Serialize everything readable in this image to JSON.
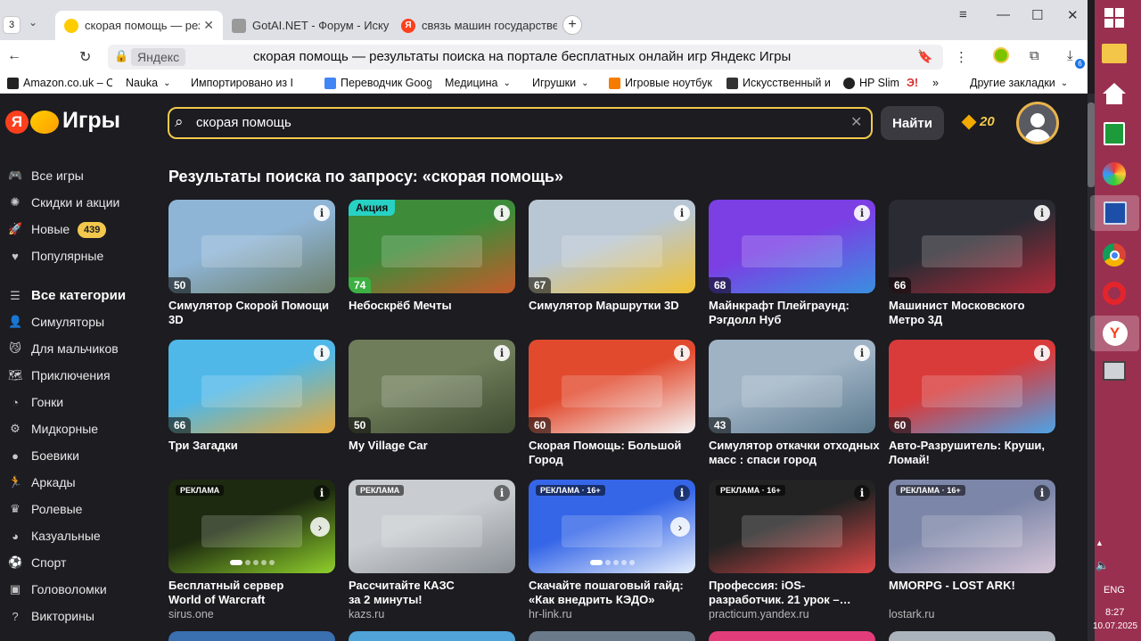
{
  "browser": {
    "tab_count": "3",
    "tabs": [
      {
        "title": "скорая помощь — резу",
        "favicon_color": "#ffcc00"
      },
      {
        "title": "GotAI.NET - Форум - Иску",
        "favicon_color": "#888888"
      },
      {
        "title": "связь машин государстве",
        "favicon_color": "#fc3f1d"
      }
    ],
    "domain_chip": "Яндекс",
    "page_title": "скорая помощь — результаты поиска на портале бесплатных онлайн игр Яндекс Игры",
    "download_badge": "6",
    "bookmarks": [
      {
        "label": "Amazon.co.uk – O",
        "color": "#222222"
      },
      {
        "label": "Nauka",
        "color": "#ffffff"
      },
      {
        "label": "Импортировано из I",
        "color": "#ffffff"
      },
      {
        "label": "Переводчик Goog",
        "color": "#4285f4"
      },
      {
        "label": "Медицина",
        "color": "#ffffff"
      },
      {
        "label": "Игрушки",
        "color": "#ffffff"
      },
      {
        "label": "Игровые ноутбук",
        "color": "#f57c00"
      },
      {
        "label": "Искусственный и",
        "color": "#333333"
      },
      {
        "label": "HP Slim",
        "color": "#222222"
      },
      {
        "label": "Другие закладки",
        "color": "#ffffff"
      }
    ]
  },
  "site": {
    "logo_text": "Игры",
    "logo_letter": "Я",
    "search_value": "скорая помощь",
    "find_button": "Найти",
    "coins": "20"
  },
  "sidebar": [
    {
      "label": "Все игры",
      "icon": "gamepad-icon",
      "glyph": "🎮"
    },
    {
      "label": "Скидки и акции",
      "icon": "discount-icon",
      "glyph": "✺"
    },
    {
      "label": "Новые",
      "icon": "rocket-icon",
      "glyph": "🚀",
      "badge": "439"
    },
    {
      "label": "Популярные",
      "icon": "heart-icon",
      "glyph": "♥"
    },
    {
      "label": "Все категории",
      "icon": "list-icon",
      "glyph": "☰",
      "heading": true
    },
    {
      "label": "Симуляторы",
      "icon": "person-icon",
      "glyph": "👤"
    },
    {
      "label": "Для мальчиков",
      "icon": "cat-icon",
      "glyph": "😼"
    },
    {
      "label": "Приключения",
      "icon": "map-icon",
      "glyph": "🗺"
    },
    {
      "label": "Гонки",
      "icon": "speed-icon",
      "glyph": "◔"
    },
    {
      "label": "Мидкорные",
      "icon": "gear-icon",
      "glyph": "⚙"
    },
    {
      "label": "Боевики",
      "icon": "bomb-icon",
      "glyph": "●"
    },
    {
      "label": "Аркады",
      "icon": "running-icon",
      "glyph": "🏃"
    },
    {
      "label": "Ролевые",
      "icon": "crown-icon",
      "glyph": "♛"
    },
    {
      "label": "Казуальные",
      "icon": "ball-icon",
      "glyph": "◕"
    },
    {
      "label": "Спорт",
      "icon": "sport-icon",
      "glyph": "⚽"
    },
    {
      "label": "Головоломки",
      "icon": "puzzle-icon",
      "glyph": "▣"
    },
    {
      "label": "Викторины",
      "icon": "quiz-icon",
      "glyph": "?"
    }
  ],
  "results_heading": "Результаты поиска по запросу: «скорая помощь»",
  "cards": [
    {
      "title1": "Симулятор Скорой Помощи",
      "title2": "3D",
      "rating": "50",
      "bg": "#8fb5d6",
      "bg2": "#6d7f6a"
    },
    {
      "title1": "Небоскрёб Мечты",
      "title2": "",
      "rating": "74",
      "bg": "#3e8c3a",
      "bg2": "#c55a2a",
      "promo": "Акция",
      "green": true
    },
    {
      "title1": "Симулятор Маршрутки 3D",
      "title2": "",
      "rating": "67",
      "bg": "#b9c6d3",
      "bg2": "#f1c232"
    },
    {
      "title1": "Майнкрафт Плейграунд:",
      "title2": "Рэгдолл Нуб",
      "rating": "68",
      "bg": "#7b3fe4",
      "bg2": "#3a8fe0"
    },
    {
      "title1": "Машинист Московского",
      "title2": "Метро 3Д",
      "rating": "66",
      "bg": "#2b2b33",
      "bg2": "#b02a3a"
    },
    {
      "title1": "Три Загадки",
      "title2": "",
      "rating": "66",
      "bg": "#4fb8e8",
      "bg2": "#e6a93a"
    },
    {
      "title1": "My Village Car",
      "title2": "",
      "rating": "50",
      "bg": "#6f7d5a",
      "bg2": "#3d4a30"
    },
    {
      "title1": "Скорая Помощь: Большой",
      "title2": "Город",
      "rating": "60",
      "bg": "#e24a2e",
      "bg2": "#f5f5f5"
    },
    {
      "title1": "Симулятор откачки отходных",
      "title2": "масс : спаси город",
      "rating": "43",
      "bg": "#9fb3c4",
      "bg2": "#5c7a8f"
    },
    {
      "title1": "Авто-Разрушитель: Круши,",
      "title2": "Ломай!",
      "rating": "60",
      "bg": "#d93a3a",
      "bg2": "#4da3e6"
    },
    {
      "title1": "Бесплатный сервер",
      "title2": "World of Warcraft",
      "sub": "sirus.one",
      "ad": "РЕКЛАМА",
      "bg": "#1d2a10",
      "bg2": "#8fd02c",
      "arrow": true,
      "dots": true
    },
    {
      "title1": "Рассчитайте КАЗС",
      "title2": "за 2 минуты!",
      "sub": "kazs.ru",
      "ad": "РЕКЛАМА",
      "bg": "#c9cdd1",
      "bg2": "#8b9096"
    },
    {
      "title1": "Скачайте пошаговый гайд:",
      "title2": "«Как внедрить КЭДО»",
      "sub": "hr-link.ru",
      "ad": "РЕКЛАМА · 16+",
      "bg": "#3566e8",
      "bg2": "#e5eefc",
      "arrow": true,
      "dots": true
    },
    {
      "title1": "Профессия: iOS-",
      "title2": "разработчик. 21 урок –…",
      "sub": "practicum.yandex.ru",
      "ad": "РЕКЛАМА · 16+",
      "bg": "#232323",
      "bg2": "#e04848"
    },
    {
      "title1": "MMORPG - LOST ARK!",
      "title2": "",
      "sub": "lostark.ru",
      "ad": "РЕКЛАМА · 16+",
      "bg": "#7c86a8",
      "bg2": "#d6c6d8"
    }
  ],
  "taskbar": {
    "language": "ENG",
    "time": "8:27",
    "date": "10.07.2025"
  }
}
